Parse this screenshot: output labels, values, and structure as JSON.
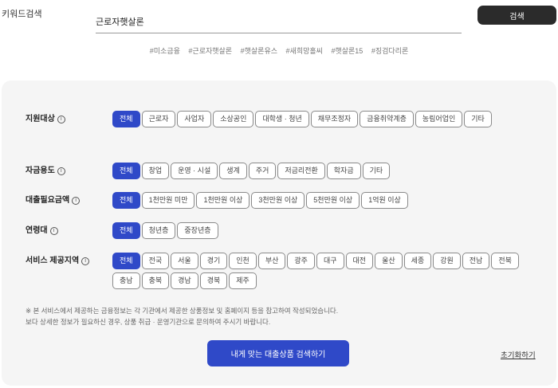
{
  "search": {
    "label": "키워드검색",
    "value": "근로자햇살론",
    "button": "검색"
  },
  "tags": [
    "#미소금융",
    "#근로자햇살론",
    "#햇살론유스",
    "#새희망홀씨",
    "#햇살론15",
    "#징검다리론"
  ],
  "filters": [
    {
      "label": "지원대상",
      "options": [
        "전체",
        "근로자",
        "사업자",
        "소상공인",
        "대학생 · 청년",
        "채무조정자",
        "금융취약계층",
        "농림어업인",
        "기타"
      ],
      "selected": "전체"
    },
    {
      "label": "자금용도",
      "options": [
        "전체",
        "창업",
        "운영 · 시설",
        "생계",
        "주거",
        "저금리전환",
        "학자금",
        "기타"
      ],
      "selected": "전체"
    },
    {
      "label": "대출필요금액",
      "options": [
        "전체",
        "1천만원 미만",
        "1천만원 이상",
        "3천만원 이상",
        "5천만원 이상",
        "1억원 이상"
      ],
      "selected": "전체"
    },
    {
      "label": "연령대",
      "options": [
        "전체",
        "청년층",
        "중장년층"
      ],
      "selected": "전체"
    },
    {
      "label": "서비스 제공지역",
      "options": [
        "전체",
        "전국",
        "서울",
        "경기",
        "인천",
        "부산",
        "광주",
        "대구",
        "대전",
        "울산",
        "세종",
        "강원",
        "전남",
        "전북",
        "충남",
        "충북",
        "경남",
        "경북",
        "제주"
      ],
      "selected": "전체"
    }
  ],
  "info_icon": "i",
  "note": {
    "line1": "※ 본 서비스에서 제공하는 금융정보는 각 기관에서 제공한 상품정보 및 홈페이지 등을 참고하여 작성되었습니다.",
    "line2": "보다 상세한 정보가 필요하신 경우, 상품 취급 · 운영기관으로 문의하여 주시기 바랍니다."
  },
  "submit_button": "내게 맞는 대출상품 검색하기",
  "reset_link": "초기화하기",
  "colors": {
    "accent": "#2f49c8",
    "dark_button": "#2b2b2b",
    "panel": "#f5f5f5"
  }
}
